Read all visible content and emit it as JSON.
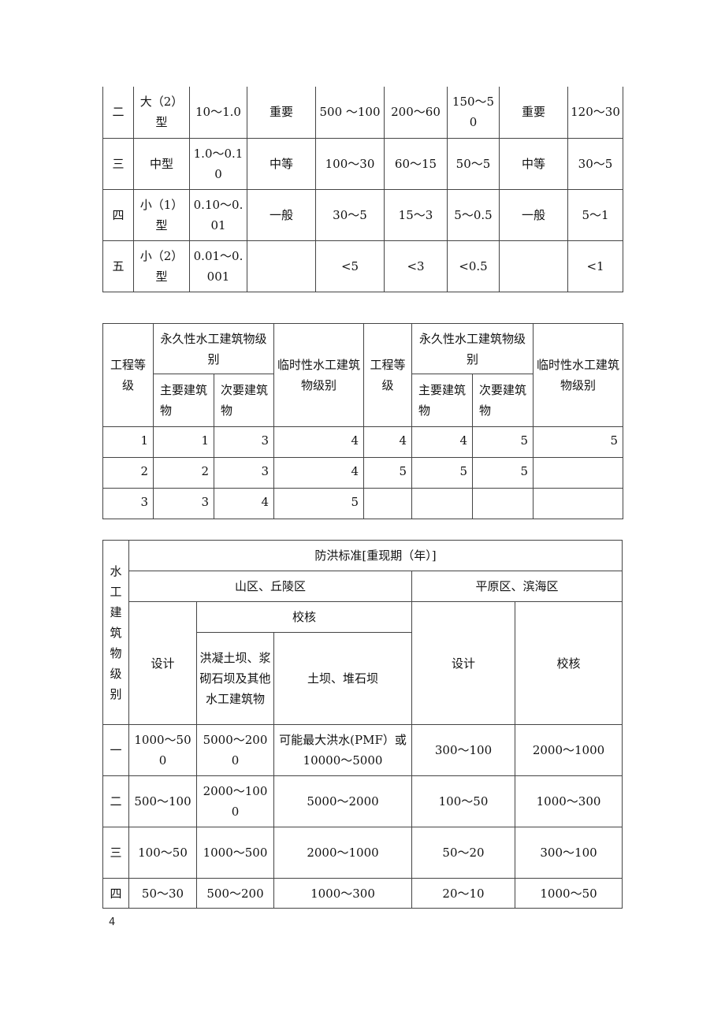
{
  "table1": {
    "rows": [
      [
        "二",
        "大（2）型",
        "10～1.0",
        "重要",
        "500 ～100",
        "200～60",
        "150～50",
        "重要",
        "120～30"
      ],
      [
        "三",
        "中型",
        "1.0～0.10",
        "中等",
        "100～30",
        "60～15",
        "50～5",
        "中等",
        "30～5"
      ],
      [
        "四",
        "小（1）型",
        "0.10～0.01",
        "一般",
        "30～5",
        "15～3",
        "5～0.5",
        "一般",
        "5～1"
      ],
      [
        "五",
        "小（2）型",
        "0.01～0.001",
        "",
        "<5",
        "<3",
        "<0.5",
        "",
        "<1"
      ]
    ]
  },
  "table2": {
    "headers": {
      "grade": "工程等级",
      "permanent": "永久性水工建筑物级别",
      "main": "主要建筑物",
      "secondary": "次要建筑物",
      "temporary": "临时性水工建筑物级别"
    },
    "rows": [
      [
        "1",
        "1",
        "3",
        "4",
        "4",
        "4",
        "5",
        "5"
      ],
      [
        "2",
        "2",
        "3",
        "4",
        "5",
        "5",
        "5",
        ""
      ],
      [
        "3",
        "3",
        "4",
        "5",
        "",
        "",
        "",
        ""
      ]
    ]
  },
  "table3": {
    "headers": {
      "level": "水工建筑物级别",
      "standard": "防洪标准[重现期（年）]",
      "mountain": "山区、丘陵区",
      "plain": "平原区、滨海区",
      "design": "设计",
      "check": "校核",
      "concrete": "洪凝土坝、浆砌石坝及其他水工建筑物",
      "earth": "土坝、堆石坝",
      "plain_design": "设计",
      "plain_check": "校核"
    },
    "rows": [
      [
        "一",
        "1000～500",
        "5000～2000",
        "可能最大洪水(PMF）或 10000～5000",
        "300～100",
        "2000～1000"
      ],
      [
        "二",
        "500～100",
        "2000～1000",
        "5000～2000",
        "100～50",
        "1000～300"
      ],
      [
        "三",
        "100～50",
        "1000～500",
        "2000～1000",
        "50～20",
        "300～100"
      ],
      [
        "四",
        "50～30",
        "500～200",
        "1000～300",
        "20～10",
        "1000～50"
      ]
    ]
  },
  "page_number": "4"
}
